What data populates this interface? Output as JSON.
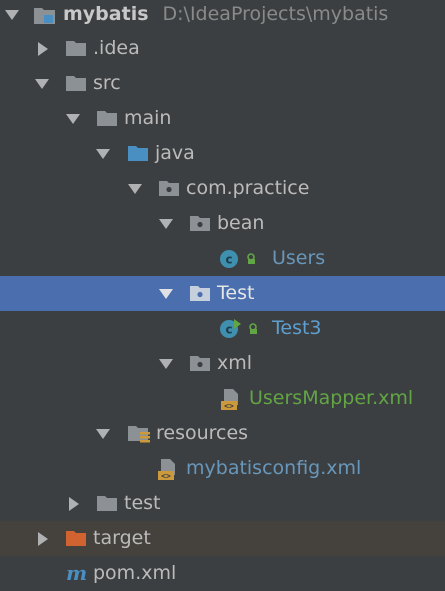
{
  "project": {
    "name": "mybatis",
    "path": "D:\\IdeaProjects\\mybatis",
    "icon": "project-folder-icon"
  },
  "nodes": {
    "idea": {
      "label": ".idea",
      "icon": "folder-icon"
    },
    "src": {
      "label": "src",
      "icon": "folder-icon"
    },
    "main": {
      "label": "main",
      "icon": "folder-icon"
    },
    "java": {
      "label": "java",
      "icon": "source-root-folder-icon"
    },
    "com_practice": {
      "label": "com.practice",
      "icon": "package-icon"
    },
    "bean": {
      "label": "bean",
      "icon": "package-icon"
    },
    "users": {
      "label": "Users",
      "icon": "java-class-icon"
    },
    "test_pkg": {
      "label": "Test",
      "icon": "package-icon"
    },
    "test3": {
      "label": "Test3",
      "icon": "java-class-runnable-icon"
    },
    "xml": {
      "label": "xml",
      "icon": "package-icon"
    },
    "users_mapper": {
      "label": "UsersMapper.xml",
      "icon": "xml-file-icon"
    },
    "resources": {
      "label": "resources",
      "icon": "resources-folder-icon"
    },
    "mybatisconfig": {
      "label": "mybatisconfig.xml",
      "icon": "xml-file-icon"
    },
    "test_dir": {
      "label": "test",
      "icon": "folder-icon"
    },
    "target": {
      "label": "target",
      "icon": "excluded-folder-icon"
    },
    "pom": {
      "label": "pom.xml",
      "icon": "maven-icon"
    }
  },
  "colors": {
    "background": "#3c3f41",
    "selection": "#4b6eaf",
    "hover": "#45413d",
    "folder": "#8c9196",
    "source_folder": "#4a8fc1",
    "excluded_folder": "#d0632f",
    "class_badge": "#3f8faf",
    "modified_green": "#62a545",
    "pushed_blue": "#6897bb"
  }
}
